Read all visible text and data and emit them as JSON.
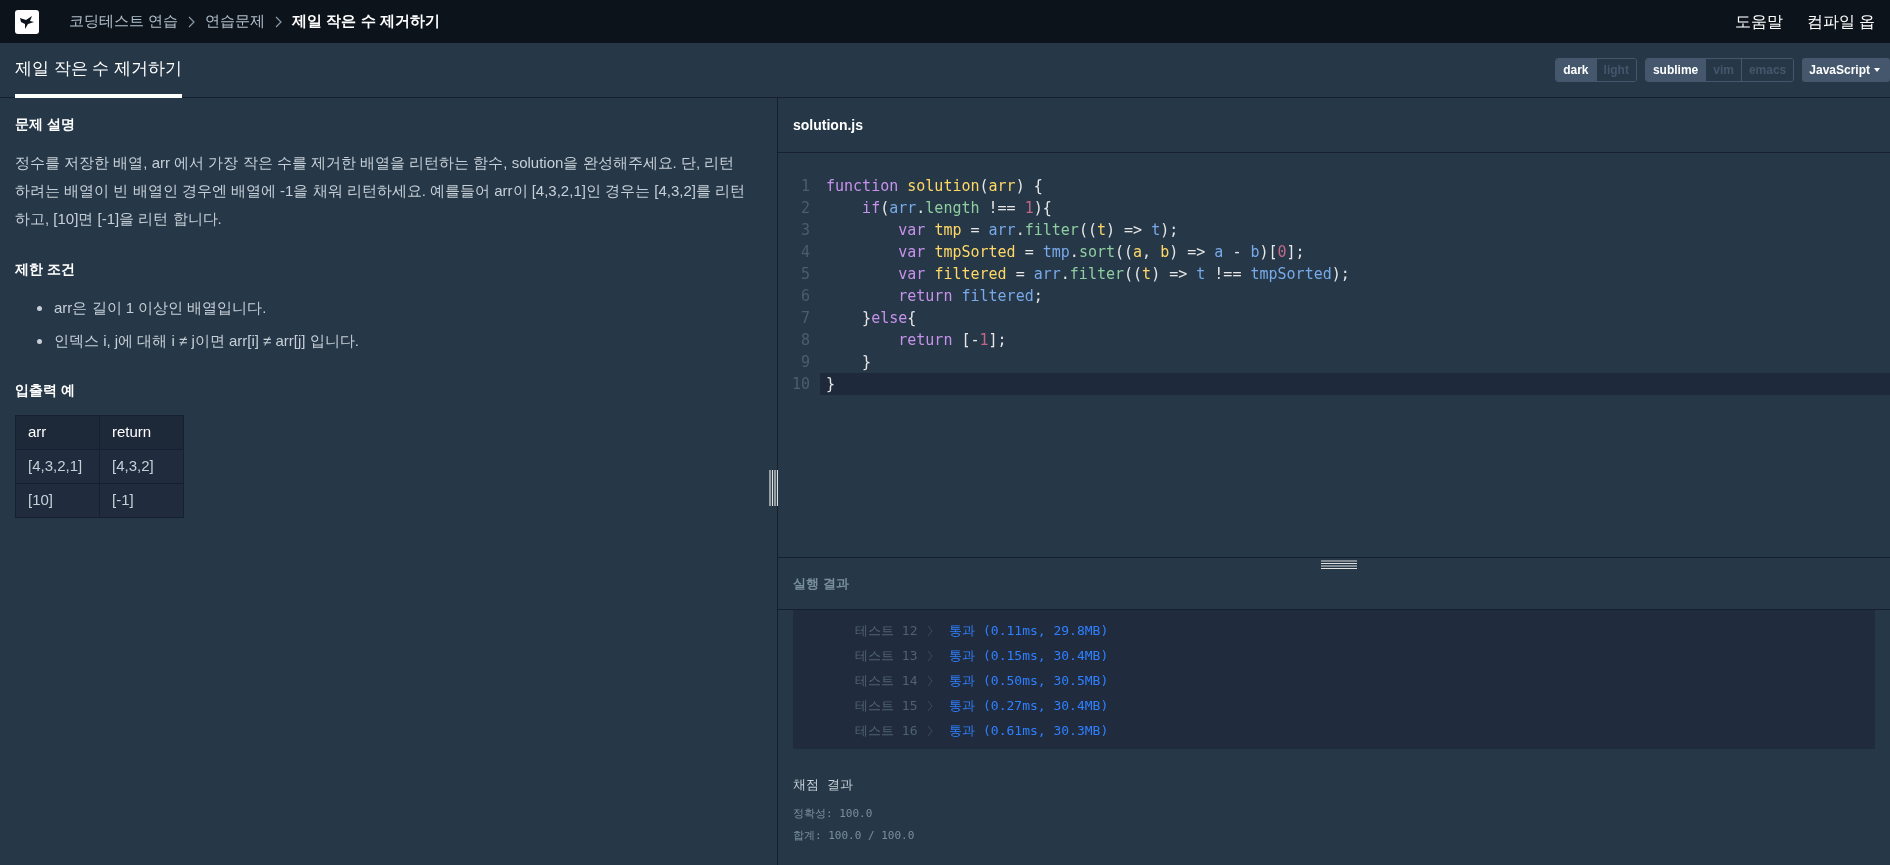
{
  "breadcrumb": [
    {
      "label": "코딩테스트 연습",
      "current": false
    },
    {
      "label": "연습문제",
      "current": false
    },
    {
      "label": "제일 작은 수 제거하기",
      "current": true
    }
  ],
  "top_links": [
    "도움말",
    "컴파일 옵"
  ],
  "tab": {
    "label": "제일 작은 수 제거하기",
    "selected": true
  },
  "theme_toggle": [
    {
      "label": "dark",
      "selected": true
    },
    {
      "label": "light",
      "selected": false
    }
  ],
  "keymap_toggle": [
    {
      "label": "sublime",
      "selected": true
    },
    {
      "label": "vim",
      "selected": false
    },
    {
      "label": "emacs",
      "selected": false
    }
  ],
  "language_select": {
    "value": "JavaScript"
  },
  "problem": {
    "heading": "문제 설명",
    "description": "정수를 저장한 배열, arr 에서 가장 작은 수를 제거한 배열을 리턴하는 함수, solution을 완성해주세요. 단, 리턴하려는 배열이 빈 배열인 경우엔 배열에 -1을 채워 리턴하세요. 예를들어 arr이 [4,3,2,1]인 경우는 [4,3,2]를 리턴 하고, [10]면 [-1]을 리턴 합니다.",
    "constraints_heading": "제한 조건",
    "constraints": [
      "arr은 길이 1 이상인 배열입니다.",
      "인덱스 i, j에 대해 i ≠ j이면 arr[i] ≠ arr[j] 입니다."
    ],
    "examples_heading": "입출력 예",
    "examples_table": {
      "columns": [
        "arr",
        "return"
      ],
      "rows": [
        [
          "[4,3,2,1]",
          "[4,3,2]"
        ],
        [
          "[10]",
          "[-1]"
        ]
      ]
    }
  },
  "editor": {
    "filename": "solution.js",
    "lines": [
      {
        "number": "1",
        "selected": false,
        "tokens": [
          {
            "kind": "keyword",
            "text": "function "
          },
          {
            "kind": "def",
            "text": "solution"
          },
          {
            "kind": "plain",
            "text": "("
          },
          {
            "kind": "def",
            "text": "arr"
          },
          {
            "kind": "plain",
            "text": ") {"
          }
        ]
      },
      {
        "number": "2",
        "selected": false,
        "tokens": [
          {
            "kind": "keyword",
            "text": "    if"
          },
          {
            "kind": "plain",
            "text": "("
          },
          {
            "kind": "ref",
            "text": "arr"
          },
          {
            "kind": "plain",
            "text": "."
          },
          {
            "kind": "method",
            "text": "length"
          },
          {
            "kind": "plain",
            "text": " !== "
          },
          {
            "kind": "number",
            "text": "1"
          },
          {
            "kind": "plain",
            "text": "){"
          }
        ]
      },
      {
        "number": "3",
        "selected": false,
        "tokens": [
          {
            "kind": "keyword",
            "text": "        var "
          },
          {
            "kind": "def",
            "text": "tmp"
          },
          {
            "kind": "plain",
            "text": " = "
          },
          {
            "kind": "ref",
            "text": "arr"
          },
          {
            "kind": "plain",
            "text": "."
          },
          {
            "kind": "method",
            "text": "filter"
          },
          {
            "kind": "plain",
            "text": "(("
          },
          {
            "kind": "def",
            "text": "t"
          },
          {
            "kind": "plain",
            "text": ") => "
          },
          {
            "kind": "ref",
            "text": "t"
          },
          {
            "kind": "plain",
            "text": ");"
          }
        ]
      },
      {
        "number": "4",
        "selected": false,
        "tokens": [
          {
            "kind": "keyword",
            "text": "        var "
          },
          {
            "kind": "def",
            "text": "tmpSorted"
          },
          {
            "kind": "plain",
            "text": " = "
          },
          {
            "kind": "ref",
            "text": "tmp"
          },
          {
            "kind": "plain",
            "text": "."
          },
          {
            "kind": "method",
            "text": "sort"
          },
          {
            "kind": "plain",
            "text": "(("
          },
          {
            "kind": "def",
            "text": "a"
          },
          {
            "kind": "plain",
            "text": ", "
          },
          {
            "kind": "def",
            "text": "b"
          },
          {
            "kind": "plain",
            "text": ") => "
          },
          {
            "kind": "ref",
            "text": "a"
          },
          {
            "kind": "plain",
            "text": " - "
          },
          {
            "kind": "ref",
            "text": "b"
          },
          {
            "kind": "plain",
            "text": ")["
          },
          {
            "kind": "number",
            "text": "0"
          },
          {
            "kind": "plain",
            "text": "];"
          }
        ]
      },
      {
        "number": "5",
        "selected": false,
        "tokens": [
          {
            "kind": "keyword",
            "text": "        var "
          },
          {
            "kind": "def",
            "text": "filtered"
          },
          {
            "kind": "plain",
            "text": " = "
          },
          {
            "kind": "ref",
            "text": "arr"
          },
          {
            "kind": "plain",
            "text": "."
          },
          {
            "kind": "method",
            "text": "filter"
          },
          {
            "kind": "plain",
            "text": "(("
          },
          {
            "kind": "def",
            "text": "t"
          },
          {
            "kind": "plain",
            "text": ") => "
          },
          {
            "kind": "ref",
            "text": "t"
          },
          {
            "kind": "plain",
            "text": " !== "
          },
          {
            "kind": "ref",
            "text": "tmpSorted"
          },
          {
            "kind": "plain",
            "text": ");"
          }
        ]
      },
      {
        "number": "6",
        "selected": false,
        "tokens": [
          {
            "kind": "keyword",
            "text": "        return "
          },
          {
            "kind": "ref",
            "text": "filtered"
          },
          {
            "kind": "plain",
            "text": ";"
          }
        ]
      },
      {
        "number": "7",
        "selected": false,
        "tokens": [
          {
            "kind": "plain",
            "text": "    }"
          },
          {
            "kind": "keyword",
            "text": "else"
          },
          {
            "kind": "plain",
            "text": "{"
          }
        ]
      },
      {
        "number": "8",
        "selected": false,
        "tokens": [
          {
            "kind": "keyword",
            "text": "        return"
          },
          {
            "kind": "plain",
            "text": " [-"
          },
          {
            "kind": "number",
            "text": "1"
          },
          {
            "kind": "plain",
            "text": "];"
          }
        ]
      },
      {
        "number": "9",
        "selected": false,
        "tokens": [
          {
            "kind": "plain",
            "text": "    }"
          }
        ]
      },
      {
        "number": "10",
        "selected": true,
        "tokens": [
          {
            "kind": "plain",
            "text": "}"
          }
        ]
      }
    ]
  },
  "results": {
    "heading": "실행 결과",
    "tests": [
      {
        "label": "테스트 12",
        "status": "통과",
        "detail": "(0.11ms, 29.8MB)"
      },
      {
        "label": "테스트 13",
        "status": "통과",
        "detail": "(0.15ms, 30.4MB)"
      },
      {
        "label": "테스트 14",
        "status": "통과",
        "detail": "(0.50ms, 30.5MB)"
      },
      {
        "label": "테스트 15",
        "status": "통과",
        "detail": "(0.27ms, 30.4MB)"
      },
      {
        "label": "테스트 16",
        "status": "통과",
        "detail": "(0.61ms, 30.3MB)"
      }
    ]
  },
  "grading": {
    "heading": "채점 결과",
    "lines": [
      "정확성: 100.0",
      "합계: 100.0 / 100.0"
    ]
  }
}
